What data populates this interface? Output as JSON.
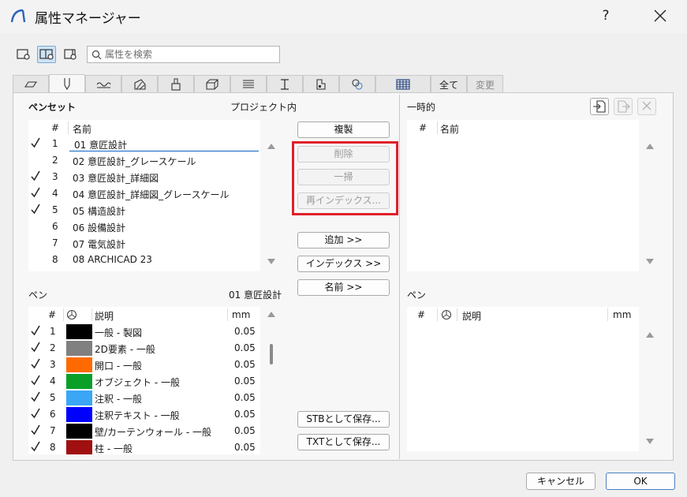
{
  "window": {
    "title": "属性マネージャー",
    "help": "?"
  },
  "search": {
    "placeholder": "属性を検索"
  },
  "tabs": {
    "all": "全て",
    "change": "変更"
  },
  "penset": {
    "label": "ペンセット",
    "location": "プロジェクト内",
    "col_num": "#",
    "col_name": "名前",
    "rows": [
      {
        "checked": true,
        "num": "1",
        "name": "01 意匠設計"
      },
      {
        "checked": false,
        "num": "2",
        "name": "02 意匠設計_グレースケール"
      },
      {
        "checked": true,
        "num": "3",
        "name": "03 意匠設計_詳細図"
      },
      {
        "checked": true,
        "num": "4",
        "name": "04 意匠設計_詳細図_グレースケール"
      },
      {
        "checked": true,
        "num": "5",
        "name": "05 構造設計"
      },
      {
        "checked": false,
        "num": "6",
        "name": "06 設備設計"
      },
      {
        "checked": false,
        "num": "7",
        "name": "07 電気設計"
      },
      {
        "checked": false,
        "num": "8",
        "name": "08 ARCHICAD 23"
      }
    ]
  },
  "pens": {
    "label": "ペン",
    "current": "01 意匠設計",
    "col_num": "#",
    "col_desc": "説明",
    "col_mm": "mm",
    "rows": [
      {
        "num": "1",
        "color": "#000000",
        "desc": "一般 - 製図",
        "mm": "0.05"
      },
      {
        "num": "2",
        "color": "#808080",
        "desc": "2D要素 - 一般",
        "mm": "0.05"
      },
      {
        "num": "3",
        "color": "#ff6a00",
        "desc": "開口 - 一般",
        "mm": "0.05"
      },
      {
        "num": "4",
        "color": "#0aa028",
        "desc": "オブジェクト - 一般",
        "mm": "0.05"
      },
      {
        "num": "5",
        "color": "#3aa6f5",
        "desc": "注釈 - 一般",
        "mm": "0.05"
      },
      {
        "num": "6",
        "color": "#0000ff",
        "desc": "注釈テキスト  - 一般",
        "mm": "0.05"
      },
      {
        "num": "7",
        "color": "#000000",
        "desc": "壁/カーテンウォール - 一般",
        "mm": "0.05"
      },
      {
        "num": "8",
        "color": "#a01010",
        "desc": "柱 - 一般",
        "mm": "0.05"
      }
    ]
  },
  "buttons": {
    "duplicate": "複製",
    "delete": "削除",
    "purge": "一掃",
    "reindex": "再インデックス...",
    "add": "追加 >>",
    "index": "インデックス >>",
    "name": "名前 >>",
    "save_stb": "STBとして保存...",
    "save_txt": "TXTとして保存...",
    "cancel": "キャンセル",
    "ok": "OK"
  },
  "temporary": {
    "label": "一時的",
    "col_num": "#",
    "col_name": "名前"
  },
  "temp_pens": {
    "label": "ペン",
    "col_num": "#",
    "col_desc": "説明",
    "col_mm": "mm"
  },
  "colors": {
    "highlight": "#e0202a",
    "selection_underline": "#0a64c8"
  }
}
